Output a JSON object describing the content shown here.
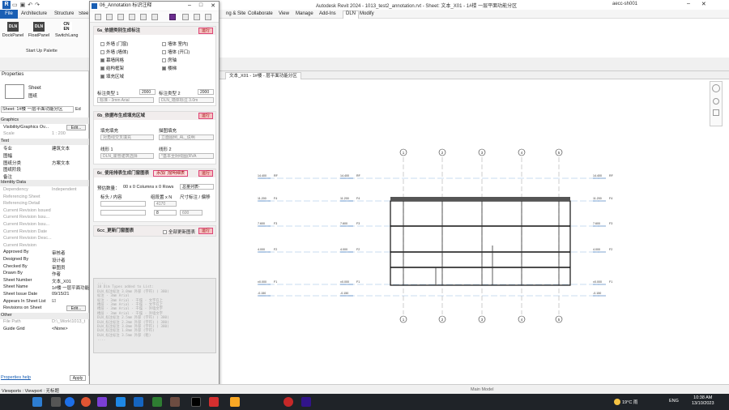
{
  "titlebar": {
    "app_title": "Autodesk Revit 2024 - 1013_test2_annotation.rvt - Sheet: 文本_X01 - 1#楼 一层平面功能分区",
    "user": "aecc-sh001",
    "logo": "R"
  },
  "menu": {
    "file": "File",
    "items": [
      "Architecture",
      "Structure",
      "Steel",
      "ng & Site",
      "Collaborate",
      "View",
      "Manage",
      "Add-Ins",
      "DLN",
      "Modify"
    ]
  },
  "ribbon": {
    "buttons": [
      {
        "icon": "DLN",
        "label": "DockPanel"
      },
      {
        "icon": "DLN",
        "label": "FloatPanel"
      },
      {
        "icon": "CN EN",
        "label": "SwitchLang"
      }
    ],
    "panel_label": "Start Up Palette"
  },
  "properties": {
    "header": "Properties",
    "type_name": "Sheet",
    "type_sub": "图纸",
    "selector": "Sheet: 1#楼 一层平面功能分区",
    "edit_type": "Ed",
    "rows": [
      {
        "k": "Graphics",
        "v": "",
        "cat": true
      },
      {
        "k": "Visibility/Graphics Ov...",
        "v": "",
        "btn": "Edit..."
      },
      {
        "k": "Scale",
        "v": "1 : 200",
        "gray": true
      },
      {
        "k": "Text",
        "v": "",
        "cat": true
      },
      {
        "k": "专业",
        "v": "建筑文本"
      },
      {
        "k": "图幅",
        "v": ""
      },
      {
        "k": "图纸分类",
        "v": "方案文本"
      },
      {
        "k": "图纸阶段",
        "v": ""
      },
      {
        "k": "备注",
        "v": ""
      },
      {
        "k": "Identity Data",
        "v": "",
        "cat": true
      },
      {
        "k": "Dependency",
        "v": "Independent",
        "gray": true
      },
      {
        "k": "Referencing Sheet",
        "v": "",
        "gray": true
      },
      {
        "k": "Referencing Detail",
        "v": "",
        "gray": true
      },
      {
        "k": "Current Revision Issued",
        "v": "",
        "gray": true
      },
      {
        "k": "Current Revision Issu...",
        "v": "",
        "gray": true
      },
      {
        "k": "Current Revision Issu...",
        "v": "",
        "gray": true
      },
      {
        "k": "Current Revision Date",
        "v": "",
        "gray": true
      },
      {
        "k": "Current Revision Desc...",
        "v": "",
        "gray": true
      },
      {
        "k": "Current Revision",
        "v": "",
        "gray": true
      },
      {
        "k": "Approved By",
        "v": "审核者"
      },
      {
        "k": "Designed By",
        "v": "设计者"
      },
      {
        "k": "Checked By",
        "v": "审图员"
      },
      {
        "k": "Drawn By",
        "v": "作者"
      },
      {
        "k": "Sheet Number",
        "v": "文本_X01"
      },
      {
        "k": "Sheet Name",
        "v": "1#楼 一层平面功能"
      },
      {
        "k": "Sheet Issue Date",
        "v": "09/15/21"
      },
      {
        "k": "Appears In Sheet List",
        "v": "☑"
      },
      {
        "k": "Revisions on Sheet",
        "v": "",
        "btn": "Edit..."
      },
      {
        "k": "Other",
        "v": "",
        "cat": true
      },
      {
        "k": "File Path",
        "v": "D:\\_Work\\1013_t",
        "gray": true
      },
      {
        "k": "Guide Grid",
        "v": "<None>"
      }
    ],
    "help": "Properties help",
    "apply": "Apply"
  },
  "view_tab": "文本_X01 - 1#楼 - 层平面功能分区",
  "dialog": {
    "title": "06_Annotation 标识注释",
    "sec1": {
      "title": "6a_依据类别生成标注",
      "run": "运行",
      "left": [
        {
          "t": "外墙 (门窗)",
          "on": false
        },
        {
          "t": "外墙 (墙体)",
          "on": false
        },
        {
          "t": "幕墙网格",
          "on": true
        },
        {
          "t": "结构框架",
          "on": true
        },
        {
          "t": "填充区域",
          "on": true
        }
      ],
      "right": [
        {
          "t": "墙体 室内)",
          "on": false
        },
        {
          "t": "墙体 (开口)",
          "on": false
        },
        {
          "t": "房轴",
          "on": false
        },
        {
          "t": "楼梯",
          "on": true
        }
      ],
      "lbl1": "标注类型 1",
      "val1": "2000",
      "lbl2": "标注类型 2",
      "val2": "2000",
      "sel1": "标准 - 3mm Arial",
      "sel2": "DLN_墙体标注 3.0m"
    },
    "sec2": {
      "title": "6b_依据布生成填充区域",
      "run": "运行",
      "lbl1": "填充填充",
      "sel1": "对角线交叉填充",
      "lbl2": "描图填充",
      "sel2": "立面图例_AL_说明",
      "lbl3": "线形 1",
      "sel3": "DLN_霍普建筑选择",
      "lbl4": "线形 2",
      "sel4": "*基本全阴线图(RVA"
    },
    "sec3": {
      "title": "6c_使用排表生成门窗图表",
      "run": "运行",
      "extra": "添加门窗明细表",
      "preview": "预估数量：",
      "preview_val": "00 x 0 Columns x 0 Rows",
      "align": "总量列表-",
      "hdr1": "标头 / 内容",
      "hdr2": "组段置 x N",
      "hdr3": "尺寸标注 / 偏移",
      "num1": "4170",
      "num2": "8",
      "num3": "600"
    },
    "sec4": {
      "title": "6cc_更新门窗图表",
      "run": "运行",
      "extra": "全部更新图表"
    },
    "log": "....\n10 Dim Types added to List:\nDLN_标注标注 3.0mm 外部 (字符) ( 380)\n标注 - 3mm Arial\n标注 - 3mm Arial - 干燥 - 文字在上\n楼层 - 3mm Arial - 干燥 - 文字在上\n楼层 - 3mm Arial - 干燥 - 外墙文字\n楼层 - 3mm Arial - 干燥 - 外墙文字\nDLN_标注标注 2.5mm 外部 (字符) ( 380)\nDLN_标注标注 2.3mm 外部 (字符) ( 380)\nDLN_标注标注 3.0mm 外部 (字符) ( 380)\nDLN_标注标注 1.8mm 外部 (字符)\nDLN_标注标注 3.5mm 外部 (粗)\n...."
  },
  "drawing": {
    "grid_labels": [
      "1",
      "2",
      "3",
      "4",
      "5"
    ],
    "levels": [
      {
        "name": "RF",
        "elev": "14.400"
      },
      {
        "name": "F4",
        "elev": "11.200"
      },
      {
        "name": "F3",
        "elev": "7.600"
      },
      {
        "name": "F2",
        "elev": "4.000"
      },
      {
        "name": "F1",
        "elev": "±0.000"
      },
      {
        "name": "",
        "elev": "-0.150"
      }
    ]
  },
  "status": {
    "text": "Viewports : Viewport : 无标题",
    "main_model": "Main Model"
  },
  "taskbar": {
    "temp": "19°C 雨",
    "lang": "ENG",
    "time": "10:38 AM",
    "date": "13/10/2023"
  }
}
